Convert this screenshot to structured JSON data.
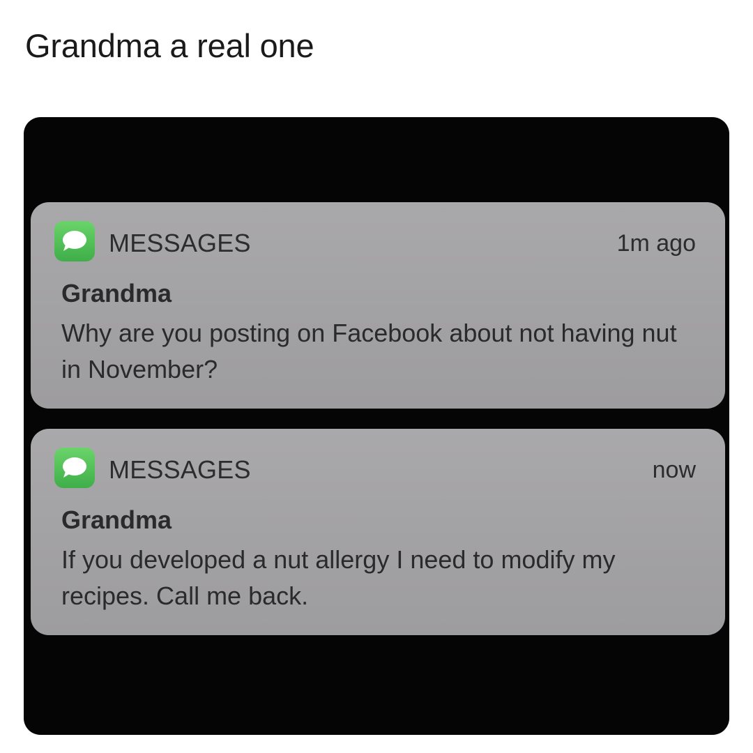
{
  "caption": "Grandma a real one",
  "notifications": [
    {
      "app": "MESSAGES",
      "time": "1m ago",
      "sender": "Grandma",
      "message": "Why are you posting on Facebook about not having nut in November?",
      "icon": "messages-app-icon"
    },
    {
      "app": "MESSAGES",
      "time": "now",
      "sender": "Grandma",
      "message": "If you developed a nut allergy I need to modify my recipes. Call me back.",
      "icon": "messages-app-icon"
    }
  ],
  "colors": {
    "screen_background": "#050505",
    "notification_background": "#a4a3a5",
    "messages_green": "#4cbf55"
  }
}
